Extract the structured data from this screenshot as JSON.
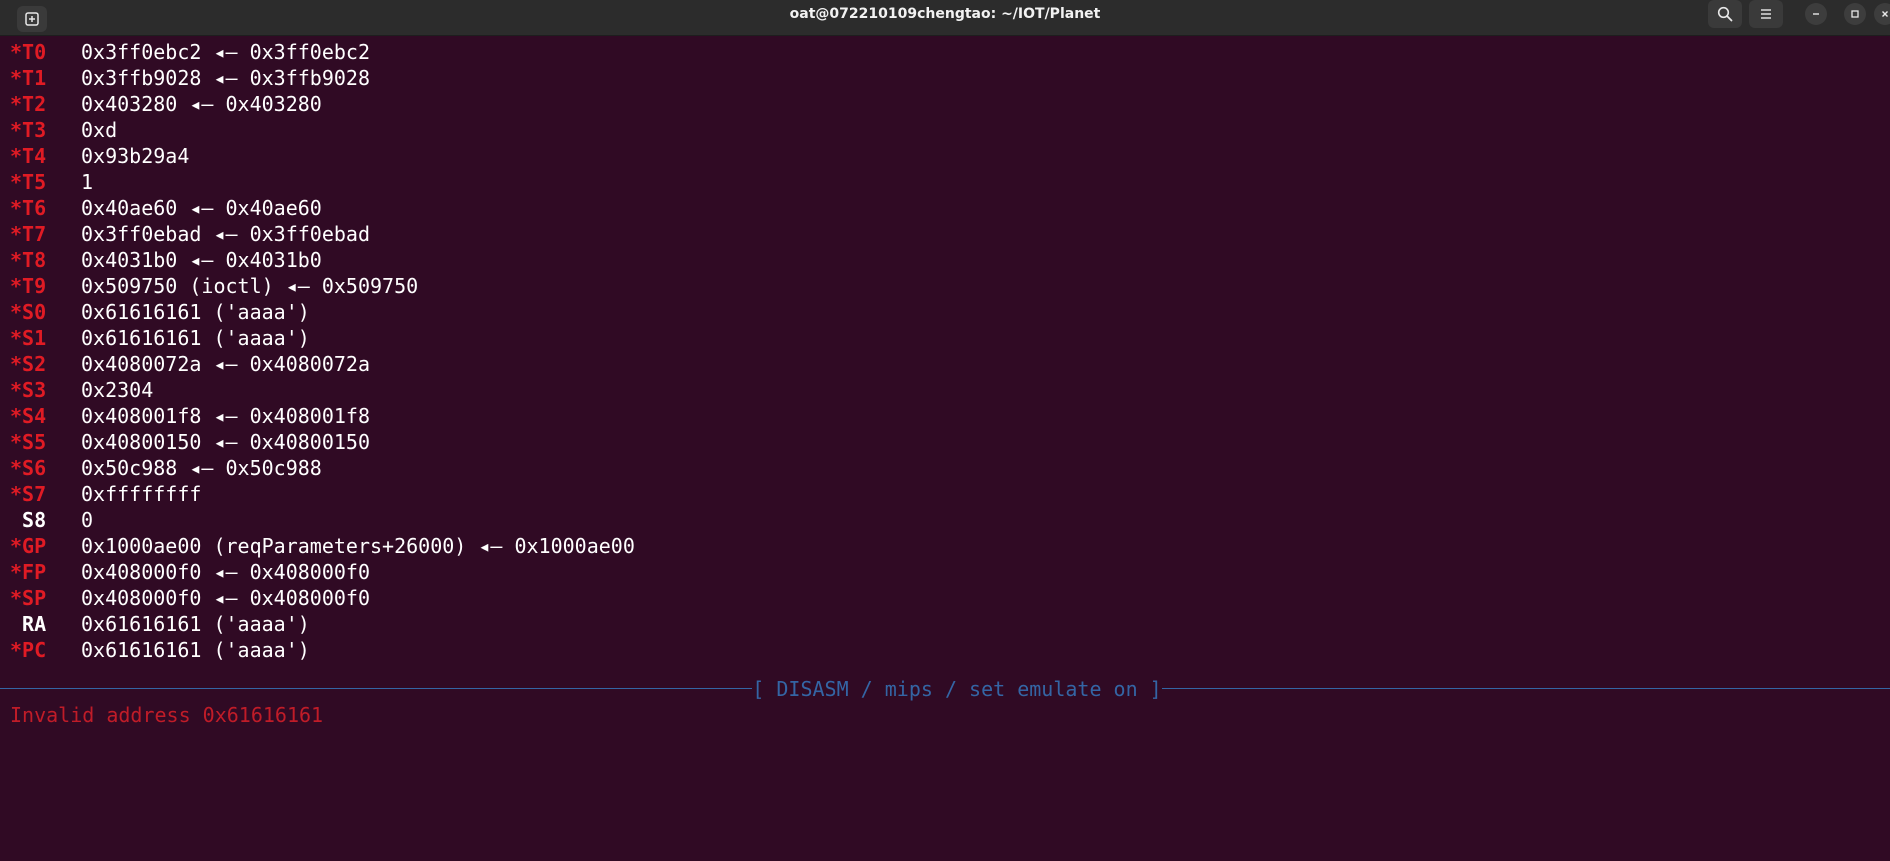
{
  "window": {
    "title": "oat@072210109chengtao: ~/IOT/Planet"
  },
  "titlebar_icons": {
    "new_tab": "new-tab-icon",
    "search": "search-icon",
    "menu": "hamburger-menu-icon",
    "minimize": "minimize-icon",
    "maximize": "maximize-icon",
    "close": "close-icon"
  },
  "registers": [
    {
      "name": "*T0",
      "value": "0x3ff0ebc2 ◂— 0x3ff0ebc2",
      "changed": true
    },
    {
      "name": "*T1",
      "value": "0x3ffb9028 ◂— 0x3ffb9028",
      "changed": true
    },
    {
      "name": "*T2",
      "value": "0x403280 ◂— 0x403280",
      "changed": true
    },
    {
      "name": "*T3",
      "value": "0xd",
      "changed": true
    },
    {
      "name": "*T4",
      "value": "0x93b29a4",
      "changed": true
    },
    {
      "name": "*T5",
      "value": "1",
      "changed": true
    },
    {
      "name": "*T6",
      "value": "0x40ae60 ◂— 0x40ae60",
      "changed": true
    },
    {
      "name": "*T7",
      "value": "0x3ff0ebad ◂— 0x3ff0ebad",
      "changed": true
    },
    {
      "name": "*T8",
      "value": "0x4031b0 ◂— 0x4031b0",
      "changed": true
    },
    {
      "name": "*T9",
      "value": "0x509750 (ioctl) ◂— 0x509750",
      "changed": true
    },
    {
      "name": "*S0",
      "value": "0x61616161 ('aaaa')",
      "changed": true
    },
    {
      "name": "*S1",
      "value": "0x61616161 ('aaaa')",
      "changed": true
    },
    {
      "name": "*S2",
      "value": "0x4080072a ◂— 0x4080072a",
      "changed": true
    },
    {
      "name": "*S3",
      "value": "0x2304",
      "changed": true
    },
    {
      "name": "*S4",
      "value": "0x408001f8 ◂— 0x408001f8",
      "changed": true
    },
    {
      "name": "*S5",
      "value": "0x40800150 ◂— 0x40800150",
      "changed": true
    },
    {
      "name": "*S6",
      "value": "0x50c988 ◂— 0x50c988",
      "changed": true
    },
    {
      "name": "*S7",
      "value": "0xffffffff",
      "changed": true
    },
    {
      "name": " S8",
      "value": "0",
      "changed": false
    },
    {
      "name": "*GP",
      "value": "0x1000ae00 (reqParameters+26000) ◂— 0x1000ae00",
      "changed": true
    },
    {
      "name": "*FP",
      "value": "0x408000f0 ◂— 0x408000f0",
      "changed": true
    },
    {
      "name": "*SP",
      "value": "0x408000f0 ◂— 0x408000f0",
      "changed": true
    },
    {
      "name": " RA",
      "value": "0x61616161 ('aaaa')",
      "changed": false
    },
    {
      "name": "*PC",
      "value": "0x61616161 ('aaaa')",
      "changed": true
    }
  ],
  "disasm_header": "[ DISASM / mips / set emulate on ]",
  "disasm_error": "Invalid address 0x61616161",
  "colors": {
    "background": "#300a24",
    "changed_register": "#e01b24",
    "divider": "#3465a4",
    "error": "#c01c28"
  }
}
